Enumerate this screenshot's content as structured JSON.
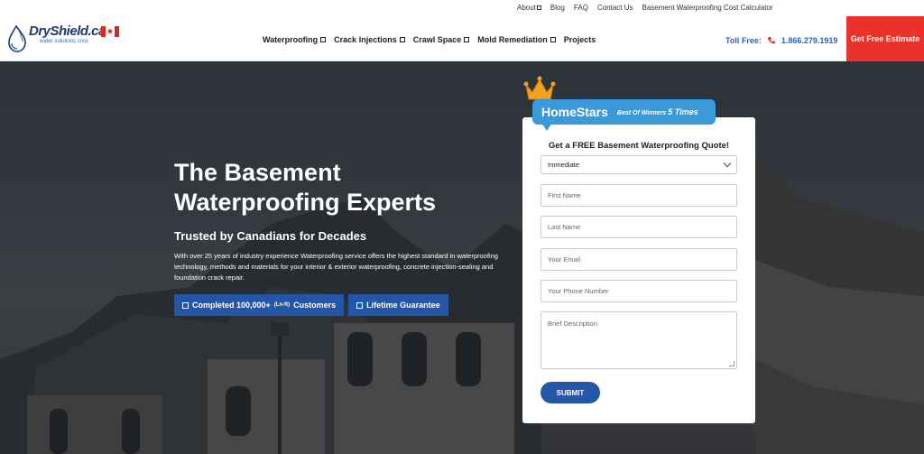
{
  "util_bar": {
    "links": [
      "About",
      "Blog",
      "FAQ",
      "Contact Us",
      "Basement Waterproofing Cost Calculator"
    ]
  },
  "header": {
    "logo_text": "DryShield.ca",
    "logo_sub": "water solutions corp.",
    "nav": [
      {
        "label": "Waterproofing",
        "dropdown": true
      },
      {
        "label": "Crack Injections",
        "dropdown": true
      },
      {
        "label": "Crawl Space",
        "dropdown": true
      },
      {
        "label": "Mold Remediation",
        "dropdown": true
      },
      {
        "label": "Projects",
        "dropdown": false
      }
    ],
    "toll_label": "Toll Free:",
    "phone": "1.866.279.1919",
    "estimate_button": "Get Free Estimate"
  },
  "hero": {
    "title_line1": "The Basement",
    "title_line2": "Waterproofing Experts",
    "subtitle": "Trusted by Canadians for Decades",
    "description": "With over 25 years of industry experience Waterproofing service offers the highest standard in waterproofing technology, methods and materials for your interior & exterior waterproofing, concrete injection-sealing and foundation crack repair.",
    "badge_customers_prefix": "Completed 100,000+",
    "badge_customers_unit": "(Ln-ft)",
    "badge_customers_suffix": "Customers",
    "badge_guarantee": "Lifetime Guarantee"
  },
  "homestars": {
    "name": "HomeStars",
    "tag_prefix": "Best Of Winners",
    "tag_count": "5 Times"
  },
  "form": {
    "title": "Get a FREE Basement Waterproofing Quote!",
    "timing_value": "Immediate",
    "first_name_placeholder": "First Name",
    "last_name_placeholder": "Last Name",
    "email_placeholder": "Your Email",
    "phone_placeholder": "Your Phone Number",
    "description_placeholder": "Brief Description",
    "submit_label": "SUBMIT"
  },
  "colors": {
    "brand_blue": "#2456a8",
    "accent_red": "#e8322a",
    "link_blue": "#2a63b8",
    "homestars_blue": "#3a9ad9"
  }
}
